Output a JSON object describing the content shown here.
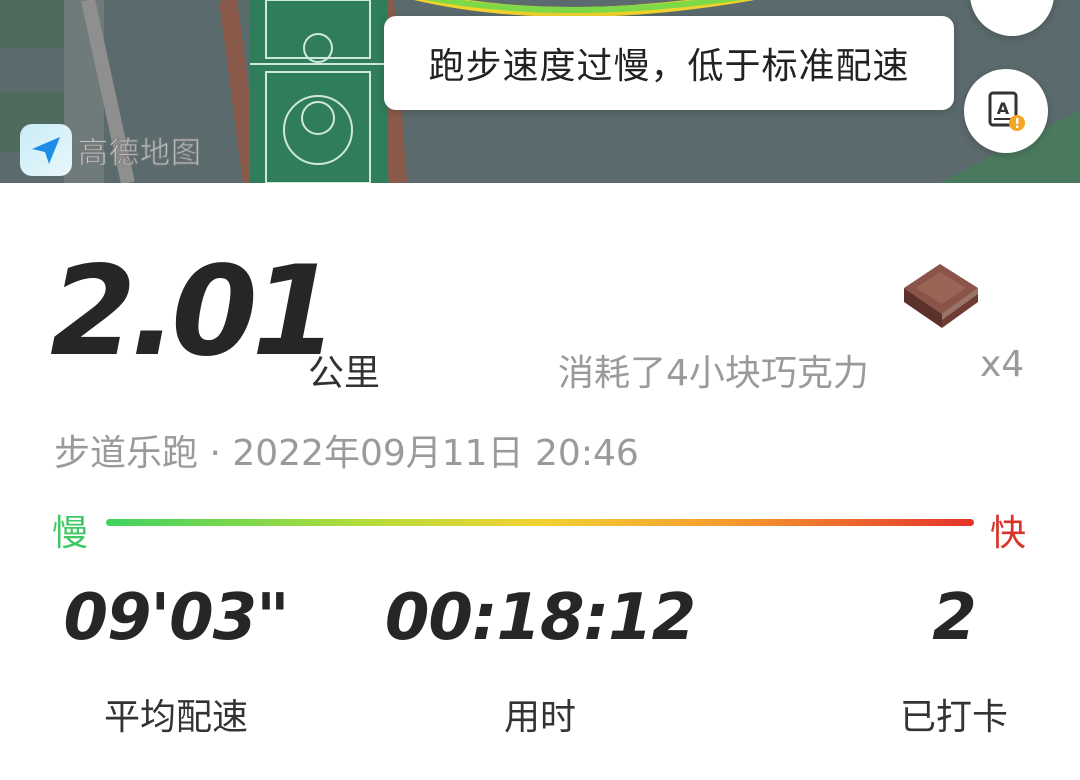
{
  "map": {
    "toast_message": "跑步速度过慢，低于标准配速",
    "provider_logo_text": "高德地图",
    "icons": [
      "top-action-icon",
      "report-icon",
      "amap-logo-icon"
    ]
  },
  "run": {
    "distance": "2.01",
    "distance_unit": "公里",
    "calorie_text": "消耗了4小块巧克力",
    "calorie_multiplier": "x4",
    "meta": "步道乐跑 · 2022年09月11日 20:46"
  },
  "speed_scale": {
    "slow_label": "慢",
    "fast_label": "快",
    "colors": [
      "#3fd25f",
      "#f2d233",
      "#e5332a"
    ]
  },
  "metrics": [
    {
      "value": "09'03\"",
      "label": "平均配速"
    },
    {
      "value": "00:18:12",
      "label": "用时"
    },
    {
      "value": "2",
      "label": "已打卡"
    }
  ]
}
